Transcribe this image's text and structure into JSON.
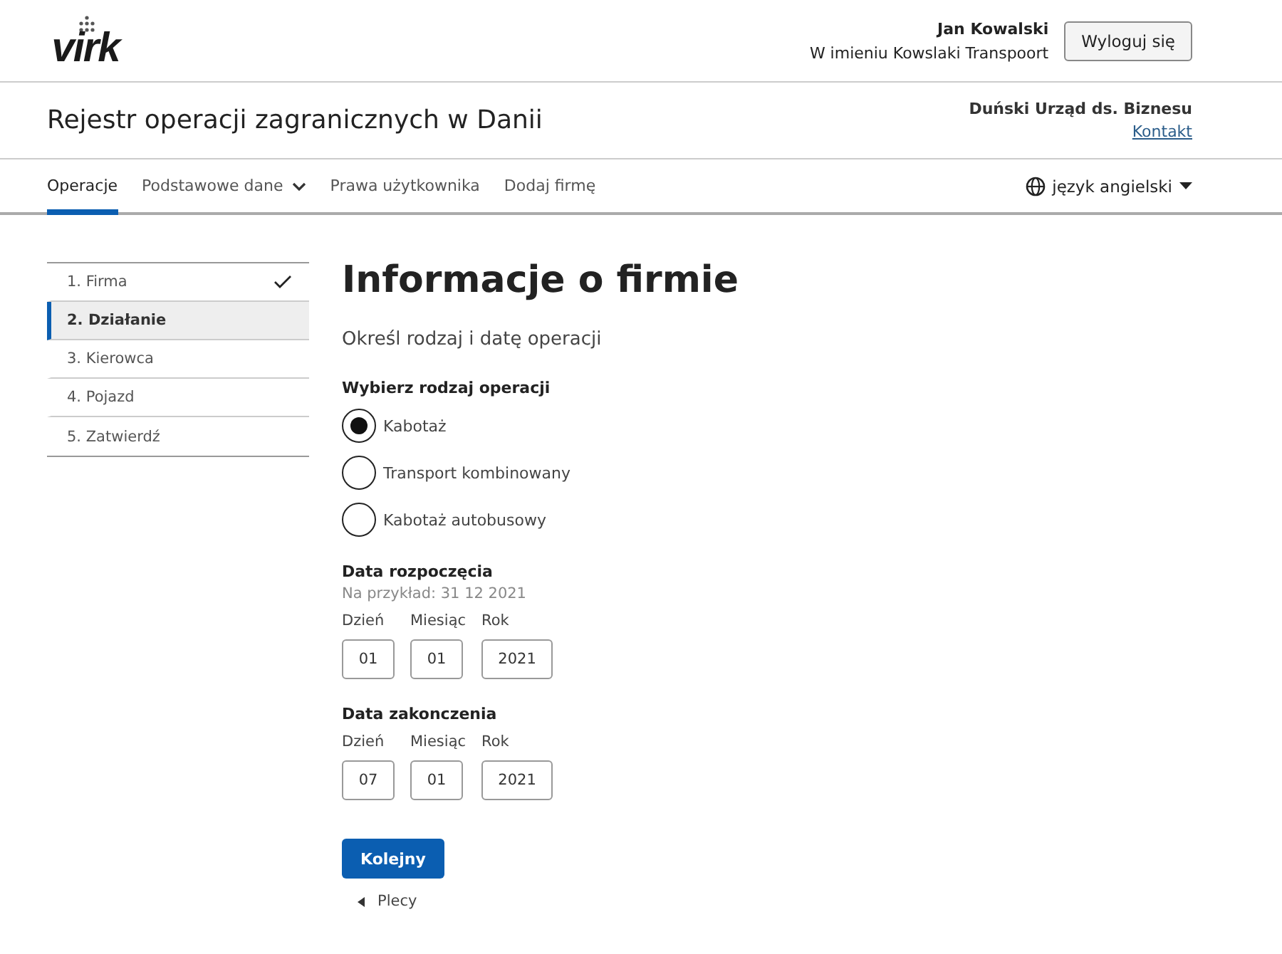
{
  "header": {
    "logo": "virk",
    "user_name": "Jan Kowalski",
    "on_behalf": "W imieniu Kowslaki Transpoort",
    "logout_button": "Wyloguj się"
  },
  "title_bar": {
    "title": "Rejestr operacji zagranicznych w Danii",
    "agency": "Duński Urząd ds. Biznesu",
    "contact_link": "Kontakt"
  },
  "nav": {
    "items": [
      {
        "label": "Operacje",
        "selected": true,
        "has_menu": false
      },
      {
        "label": "Podstawowe dane",
        "selected": false,
        "has_menu": true
      },
      {
        "label": "Prawa użytkownika",
        "selected": false,
        "has_menu": false
      },
      {
        "label": "Dodaj firmę",
        "selected": false,
        "has_menu": false
      }
    ],
    "language": "język angielski"
  },
  "steps": [
    {
      "label": "1. Firma",
      "selected": false,
      "completed": true
    },
    {
      "label": "2. Działanie",
      "selected": true,
      "completed": false
    },
    {
      "label": "3. Kierowca",
      "selected": false,
      "completed": false
    },
    {
      "label": "4. Pojazd",
      "selected": false,
      "completed": false
    },
    {
      "label": "5. Zatwierdź",
      "selected": false,
      "completed": false
    }
  ],
  "form": {
    "heading": "Informacje o firmie",
    "subtitle": "Określ rodzaj i datę operacji",
    "operation_label": "Wybierz rodzaj operacji",
    "options": [
      {
        "label": "Kabotaż",
        "selected": true
      },
      {
        "label": "Transport kombinowany",
        "selected": false
      },
      {
        "label": "Kabotaż autobusowy",
        "selected": false
      }
    ],
    "dates": [
      {
        "label": "Data rozpoczęcia",
        "hint": "Na przykład: 31 12 2021",
        "fields": [
          {
            "label": "Dzień",
            "value": "01",
            "kind": "short"
          },
          {
            "label": "Miesiąc",
            "value": "01",
            "kind": "short"
          },
          {
            "label": "Rok",
            "value": "2021",
            "kind": "long"
          }
        ]
      },
      {
        "label": "Data zakonczenia",
        "fields": [
          {
            "label": "Dzień",
            "value": "07",
            "kind": "short"
          },
          {
            "label": "Miesiąc",
            "value": "01",
            "kind": "short"
          },
          {
            "label": "Rok",
            "value": "2021",
            "kind": "long"
          }
        ]
      }
    ],
    "next_button": "Kolejny",
    "back_link": "Plecy"
  }
}
